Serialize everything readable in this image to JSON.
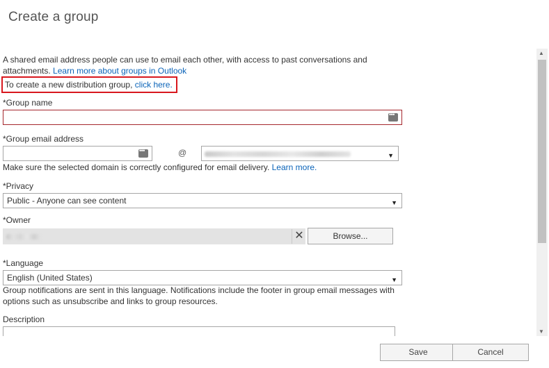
{
  "title": "Create a group",
  "intro": {
    "text": "A shared email address people can use to email each other, with access to past conversations and attachments. ",
    "learn_link": "Learn more about groups in Outlook"
  },
  "distribution": {
    "text": "To create a new distribution group, ",
    "link": "click here."
  },
  "group_name": {
    "label": "*Group name",
    "value": "",
    "icon": "more-dots-icon"
  },
  "group_email": {
    "label": "*Group email address",
    "value": "",
    "at": "@",
    "domain_value": "",
    "note_text": "Make sure the selected domain is correctly configured for email delivery. ",
    "note_link": "Learn more."
  },
  "privacy": {
    "label": "*Privacy",
    "selected": "Public - Anyone can see content"
  },
  "owner": {
    "label": "*Owner",
    "clear_glyph": "✕",
    "browse_label": "Browse..."
  },
  "language": {
    "label": "*Language",
    "selected": "English (United States)",
    "note": "Group notifications are sent in this language. Notifications include the footer in group email messages with options such as unsubscribe and links to group resources."
  },
  "description": {
    "label": "Description",
    "value": ""
  },
  "footer": {
    "save_label": "Save",
    "cancel_label": "Cancel"
  },
  "colors": {
    "link": "#0a63b8",
    "highlight_border": "#d8171d",
    "error_border": "#a4262c"
  }
}
